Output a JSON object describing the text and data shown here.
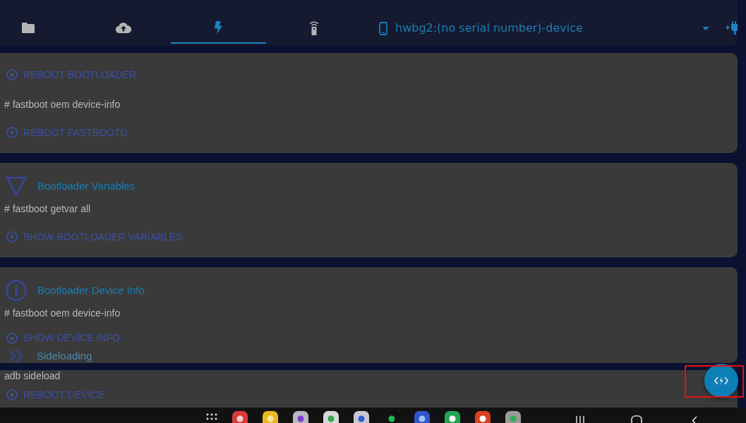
{
  "tabs": [
    {
      "kind": "files",
      "selected": false
    },
    {
      "kind": "upload",
      "selected": false
    },
    {
      "kind": "flash",
      "selected": true
    },
    {
      "kind": "remote",
      "selected": false
    }
  ],
  "device_selector": {
    "label": "hwbg2:(no serial number)-device"
  },
  "cards": [
    {
      "rows": [
        {
          "kind": "action",
          "label": "REBOOT BOOTLOADER"
        },
        {
          "kind": "command",
          "text": "# fastboot oem device-info"
        },
        {
          "kind": "action",
          "label": "REBOOT FASTBOOTD"
        }
      ]
    },
    {
      "rows": [
        {
          "kind": "heading",
          "title": "Bootloader Variables",
          "faded": false
        },
        {
          "kind": "command",
          "text": "# fastboot getvar all"
        },
        {
          "kind": "action",
          "label": "SHOW BOOTLOADER VARİABLES"
        }
      ]
    },
    {
      "rows": [
        {
          "kind": "heading",
          "title": "Bootloader Device Info",
          "faded": false
        },
        {
          "kind": "command",
          "text": "# fastboot oem device-info"
        },
        {
          "kind": "action",
          "label": "SHOW DEVİCE İNFO"
        },
        {
          "kind": "heading",
          "title": "Sideloading",
          "faded": true
        }
      ]
    },
    {
      "rows": [
        {
          "kind": "command",
          "text": "adb sideload"
        },
        {
          "kind": "action",
          "label": "REBOOT DEVİCE"
        }
      ]
    }
  ],
  "fab": {
    "highlighted": true
  }
}
